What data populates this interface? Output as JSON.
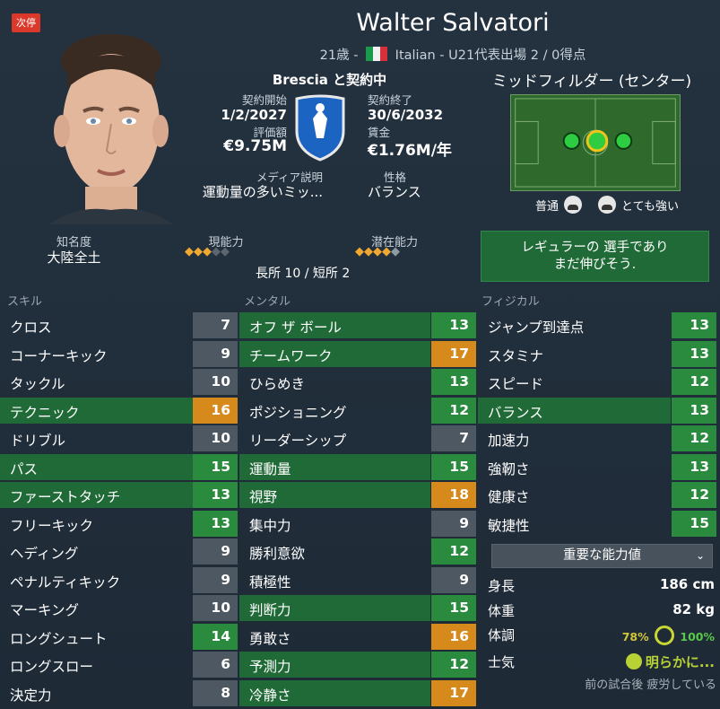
{
  "badge": "次停",
  "player": {
    "name": "Walter Salvatori",
    "age": "21歳",
    "sep1": "-",
    "nationality": "Italian",
    "sep2": "-",
    "intl": "U21代表出場 2 / 0得点"
  },
  "contract": {
    "title": "Brescia と契約中",
    "start_label": "契約開始",
    "start_value": "1/2/2027",
    "end_label": "契約終了",
    "end_value": "30/6/2032",
    "value_label": "評価額",
    "value": "€9.75M",
    "wage_label": "賃金",
    "wage": "€1.76M/年",
    "media_label": "メディア説明",
    "media_value": "運動量の多いミッ...",
    "personality_label": "性格",
    "personality_value": "バランス"
  },
  "position": {
    "title": "ミッドフィルダー (センター)",
    "foot_left_label": "普通",
    "foot_right_label": "とても強い"
  },
  "fame": {
    "label": "知名度",
    "value": "大陸全土"
  },
  "ability": {
    "current_label": "現能力",
    "potential_label": "潜在能力",
    "current_stars": 3,
    "potential_stars": 4.5,
    "strengths": "長所 10 / 短所 2"
  },
  "verdict": {
    "line1": "レギュラーの 選手であり",
    "line2": "まだ伸びそう."
  },
  "sections": {
    "skills": "スキル",
    "mental": "メンタル",
    "physical": "フィジカル"
  },
  "skills": [
    {
      "label": "クロス",
      "value": "7",
      "hl": false,
      "c": "grey"
    },
    {
      "label": "コーナーキック",
      "value": "9",
      "hl": false,
      "c": "grey"
    },
    {
      "label": "タックル",
      "value": "10",
      "hl": false,
      "c": "grey"
    },
    {
      "label": "テクニック",
      "value": "16",
      "hl": true,
      "c": "orange"
    },
    {
      "label": "ドリブル",
      "value": "10",
      "hl": false,
      "c": "grey"
    },
    {
      "label": "パス",
      "value": "15",
      "hl": true,
      "c": "green"
    },
    {
      "label": "ファーストタッチ",
      "value": "13",
      "hl": true,
      "c": "green"
    },
    {
      "label": "フリーキック",
      "value": "13",
      "hl": false,
      "c": "green"
    },
    {
      "label": "ヘディング",
      "value": "9",
      "hl": false,
      "c": "grey"
    },
    {
      "label": "ペナルティキック",
      "value": "9",
      "hl": false,
      "c": "grey"
    },
    {
      "label": "マーキング",
      "value": "10",
      "hl": false,
      "c": "grey"
    },
    {
      "label": "ロングシュート",
      "value": "14",
      "hl": false,
      "c": "green"
    },
    {
      "label": "ロングスロー",
      "value": "6",
      "hl": false,
      "c": "grey"
    },
    {
      "label": "決定力",
      "value": "8",
      "hl": false,
      "c": "grey"
    }
  ],
  "mental": [
    {
      "label": "オフ ザ ボール",
      "value": "13",
      "hl": true,
      "c": "green"
    },
    {
      "label": "チームワーク",
      "value": "17",
      "hl": true,
      "c": "orange"
    },
    {
      "label": "ひらめき",
      "value": "13",
      "hl": false,
      "c": "green"
    },
    {
      "label": "ポジショニング",
      "value": "12",
      "hl": false,
      "c": "green"
    },
    {
      "label": "リーダーシップ",
      "value": "7",
      "hl": false,
      "c": "grey"
    },
    {
      "label": "運動量",
      "value": "15",
      "hl": true,
      "c": "green"
    },
    {
      "label": "視野",
      "value": "18",
      "hl": true,
      "c": "orange"
    },
    {
      "label": "集中力",
      "value": "9",
      "hl": false,
      "c": "grey"
    },
    {
      "label": "勝利意欲",
      "value": "12",
      "hl": false,
      "c": "green"
    },
    {
      "label": "積極性",
      "value": "9",
      "hl": false,
      "c": "grey"
    },
    {
      "label": "判断力",
      "value": "15",
      "hl": true,
      "c": "green"
    },
    {
      "label": "勇敢さ",
      "value": "16",
      "hl": false,
      "c": "orange"
    },
    {
      "label": "予測力",
      "value": "12",
      "hl": true,
      "c": "green"
    },
    {
      "label": "冷静さ",
      "value": "17",
      "hl": true,
      "c": "orange"
    }
  ],
  "physical": [
    {
      "label": "ジャンプ到達点",
      "value": "13",
      "hl": false,
      "c": "green"
    },
    {
      "label": "スタミナ",
      "value": "13",
      "hl": false,
      "c": "green"
    },
    {
      "label": "スピード",
      "value": "12",
      "hl": false,
      "c": "green"
    },
    {
      "label": "バランス",
      "value": "13",
      "hl": true,
      "c": "green"
    },
    {
      "label": "加速力",
      "value": "12",
      "hl": false,
      "c": "green"
    },
    {
      "label": "強靭さ",
      "value": "13",
      "hl": false,
      "c": "green"
    },
    {
      "label": "健康さ",
      "value": "12",
      "hl": false,
      "c": "green"
    },
    {
      "label": "敏捷性",
      "value": "15",
      "hl": false,
      "c": "green"
    }
  ],
  "key_attributes_dropdown": "重要な能力値",
  "info": {
    "height_label": "身長",
    "height": "186 cm",
    "weight_label": "体重",
    "weight": "82 kg",
    "condition_label": "体調",
    "condition_low": "78%",
    "condition_high": "100%",
    "morale_label": "士気",
    "morale": "明らかに...",
    "note": "前の試合後 疲労している"
  },
  "colors": {
    "green": "#2a8a3e",
    "orange": "#d68a1c",
    "grey": "#4e5862",
    "highlight": "#1f6a36"
  }
}
